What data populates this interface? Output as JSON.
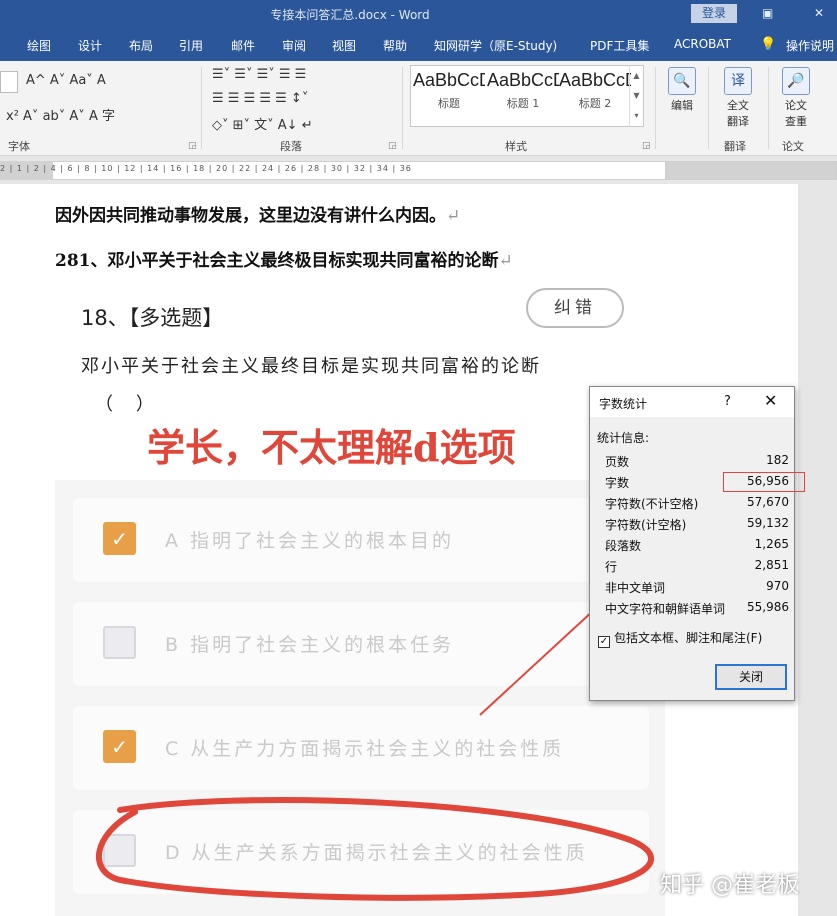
{
  "titlebar": {
    "title": "专接本问答汇总.docx - Word",
    "login": "登录",
    "restore_glyph": "▣",
    "close_glyph": "✕"
  },
  "tabs": [
    "绘图",
    "设计",
    "布局",
    "引用",
    "邮件",
    "审阅",
    "视图",
    "帮助",
    "知网研学（原E-Study)",
    "PDF工具集",
    "ACROBAT",
    "操作说明"
  ],
  "tell_me_icon": "lightbulb-icon",
  "ribbon": {
    "font_group": "字体",
    "paragraph_group": "段落",
    "styles_group": "样式",
    "translate_group": "翻译",
    "paper_group": "论文",
    "styles": [
      {
        "sample": "AaBbCcD",
        "name": "标题"
      },
      {
        "sample": "AaBbCcD",
        "name": "标题 1"
      },
      {
        "sample": "AaBbCcD",
        "name": "标题 2"
      }
    ],
    "edit_label": "编辑",
    "translate_line1": "全文",
    "translate_line2": "翻译",
    "paper_line1": "论文",
    "paper_line2": "查重",
    "font_row1": "A^  A˅  Aa˅   A",
    "font_row2": "x²  A˅  ab˅  A˅  A  字",
    "para_row1": "☰˅ ☰˅ ☰˅  ☰ ☰",
    "para_row2": "☰ ☰ ☰ ☰ ☰  ↕˅",
    "para_row3": "◇˅ ⊞˅  文˅  A↓  ↵"
  },
  "ruler_numbers": "2 |  1 |  2 |  4 |  6 |  8 |  10 |  12 |  14 |  16 |  18 |  20 |  22 |  24 |  26 |  28 |  30 |  32 |  34 |  36",
  "document": {
    "line1": "因外因共同推动事物发展，这里边没有讲什么内因。",
    "line2": "281、邓小平关于社会主义最终极目标实现共同富裕的论断",
    "para_mark": "↵"
  },
  "question": {
    "number": "18、【多选题】",
    "correct_button": "纠错",
    "stem": "邓小平关于社会主义最终目标是实现共同富裕的论断",
    "paren": "（    ）",
    "options": [
      {
        "text": "A  指明了社会主义的根本目的",
        "checked": true
      },
      {
        "text": "B  指明了社会主义的根本任务",
        "checked": false
      },
      {
        "text": "C  从生产力方面揭示社会主义的社会性质",
        "checked": true
      },
      {
        "text": "D  从生产关系方面揭示社会主义的社会性质",
        "checked": false
      }
    ],
    "check_glyph": "✓"
  },
  "annotation": {
    "text": "学长，不太理解d选项",
    "color": "#e0473b"
  },
  "dialog": {
    "title": "字数统计",
    "help": "?",
    "close": "✕",
    "section": "统计信息:",
    "stats": [
      {
        "label": "页数",
        "value": "182"
      },
      {
        "label": "字数",
        "value": "56,956"
      },
      {
        "label": "字符数(不计空格)",
        "value": "57,670"
      },
      {
        "label": "字符数(计空格)",
        "value": "59,132"
      },
      {
        "label": "段落数",
        "value": "1,265"
      },
      {
        "label": "行",
        "value": "2,851"
      },
      {
        "label": "非中文单词",
        "value": "970"
      },
      {
        "label": "中文字符和朝鲜语单词",
        "value": "55,986"
      }
    ],
    "include_label": "包括文本框、脚注和尾注(F)",
    "include_checked": "✓",
    "close_button": "关闭"
  },
  "watermark": "知乎 @崔老板",
  "colors": {
    "word_blue": "#2b579a",
    "checkbox_orange": "#e8a048",
    "annotation_red": "#e0473b"
  }
}
